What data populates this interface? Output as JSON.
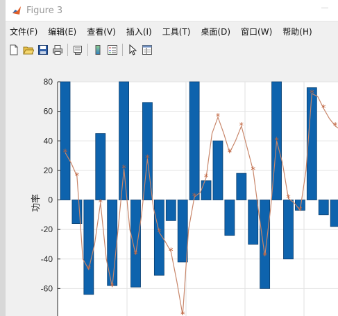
{
  "window": {
    "title": "Figure 3"
  },
  "menu": [
    {
      "label": "文件(F)"
    },
    {
      "label": "编辑(E)"
    },
    {
      "label": "查看(V)"
    },
    {
      "label": "插入(I)"
    },
    {
      "label": "工具(T)"
    },
    {
      "label": "桌面(D)"
    },
    {
      "label": "窗口(W)"
    },
    {
      "label": "帮助(H)"
    }
  ],
  "toolbar": [
    "new-figure-icon",
    "open-file-icon",
    "save-icon",
    "print-icon",
    "print-preview-icon",
    "colorbar-icon",
    "legend-icon",
    "pointer-icon",
    "property-editor-icon"
  ],
  "chart_data": {
    "type": "bar",
    "title": "",
    "xlabel": "",
    "ylabel": "功率",
    "ylim": [
      -78,
      80
    ],
    "yticks": [
      "80",
      "60",
      "40",
      "20",
      "0",
      "-20",
      "-40",
      "-60"
    ],
    "grid": true,
    "bar_color": "#0e63ad",
    "line_color": "#c8866a",
    "x": [
      1,
      2,
      3,
      4,
      5,
      6,
      7,
      8,
      9,
      10,
      11,
      12,
      13,
      14,
      15,
      16,
      17,
      18,
      19,
      20,
      21,
      22,
      23,
      24,
      25,
      26,
      27,
      28,
      29,
      30,
      31,
      32,
      33,
      34,
      35,
      36,
      37,
      38,
      39,
      40,
      41,
      42,
      43,
      44,
      45,
      46,
      47,
      48
    ],
    "series": [
      {
        "kind": "bar",
        "values": [
          80,
          -16,
          -64,
          45,
          -58,
          80,
          -59,
          66,
          -51,
          -14,
          -42,
          80,
          13,
          40,
          -24,
          18,
          -30,
          -60,
          80,
          -40,
          -7,
          76,
          -10,
          -18
        ]
      },
      {
        "kind": "line",
        "marker": "*",
        "values": [
          32,
          25,
          16,
          -40,
          -47,
          -30,
          -2,
          -40,
          -59,
          -20,
          21,
          -20,
          -37,
          -10,
          28,
          -5,
          -22,
          -28,
          -35,
          -55,
          -78,
          -20,
          2,
          5,
          15,
          45,
          56,
          45,
          32,
          40,
          50,
          35,
          20,
          -10,
          -38,
          -5,
          40,
          25,
          1,
          -2,
          -7,
          20,
          72,
          70,
          62,
          55,
          50,
          47
        ]
      }
    ]
  }
}
